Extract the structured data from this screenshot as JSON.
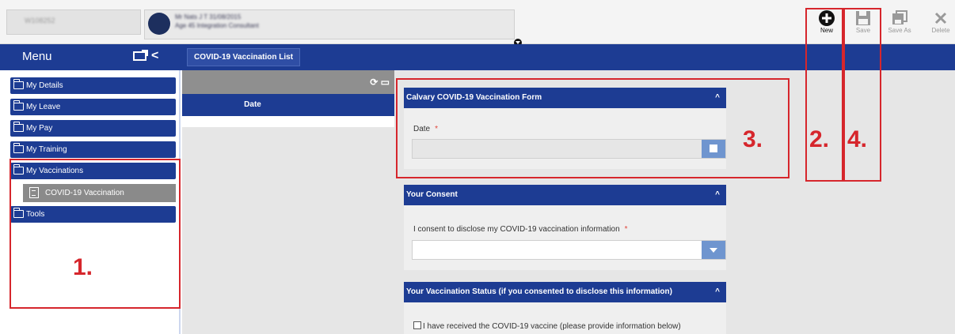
{
  "topbar": {
    "employee_id": "W108252",
    "user_line1": "Mr Nats J T 31/08/2015",
    "user_line2": "Age 45 Integration Consultant"
  },
  "toolbar": {
    "new_label": "New",
    "save_label": "Save",
    "save_as_label": "Save As",
    "delete_label": "Delete"
  },
  "menu": {
    "title": "Menu"
  },
  "tab": {
    "label": "COVID-19 Vaccination List"
  },
  "sidebar": {
    "items": [
      {
        "label": "My Details"
      },
      {
        "label": "My Leave"
      },
      {
        "label": "My Pay"
      },
      {
        "label": "My Training"
      },
      {
        "label": "My Vaccinations"
      },
      {
        "label": "Tools"
      }
    ],
    "sub_item": {
      "label": "COVID-19 Vaccination"
    }
  },
  "list": {
    "column_date": "Date"
  },
  "form": {
    "section1": {
      "title": "Calvary COVID-19 Vaccination Form",
      "date_label": "Date"
    },
    "section2": {
      "title": "Your Consent",
      "consent_label": "I consent to disclose my COVID-19 vaccination information"
    },
    "section3": {
      "title": "Your Vaccination Status (if you consented to disclose this information)",
      "received_label": "I have received the COVID-19 vaccine (please provide information below)"
    },
    "required_mark": "*",
    "caret": "^"
  },
  "annotations": {
    "n1": "1.",
    "n2": "2.",
    "n3": "3.",
    "n4": "4."
  },
  "colors": {
    "primary_blue": "#1d3c93",
    "annotation_red": "#d6262c"
  }
}
